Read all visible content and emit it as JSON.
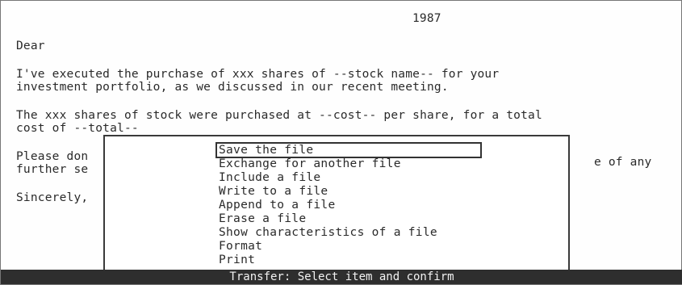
{
  "document": {
    "date": "1987",
    "lines": [
      "Dear",
      "I've executed the purchase of xxx shares of --stock name-- for your",
      "investment portfolio, as we discussed in our recent meeting.",
      "The xxx shares of stock were purchased at --cost-- per share, for a total",
      "cost of --total--",
      "Please don",
      "further se",
      "Sincerely,"
    ],
    "partial_right": [
      "e of any"
    ]
  },
  "menu": {
    "items": [
      "Save the file",
      "Exchange for another file",
      "Include a file",
      "Write to a file",
      "Append to a file",
      "Erase a file",
      "Show characteristics of a file",
      "Format",
      "Print"
    ],
    "selected_index": 0
  },
  "status_bar": {
    "text": "Transfer: Select item and confirm"
  }
}
